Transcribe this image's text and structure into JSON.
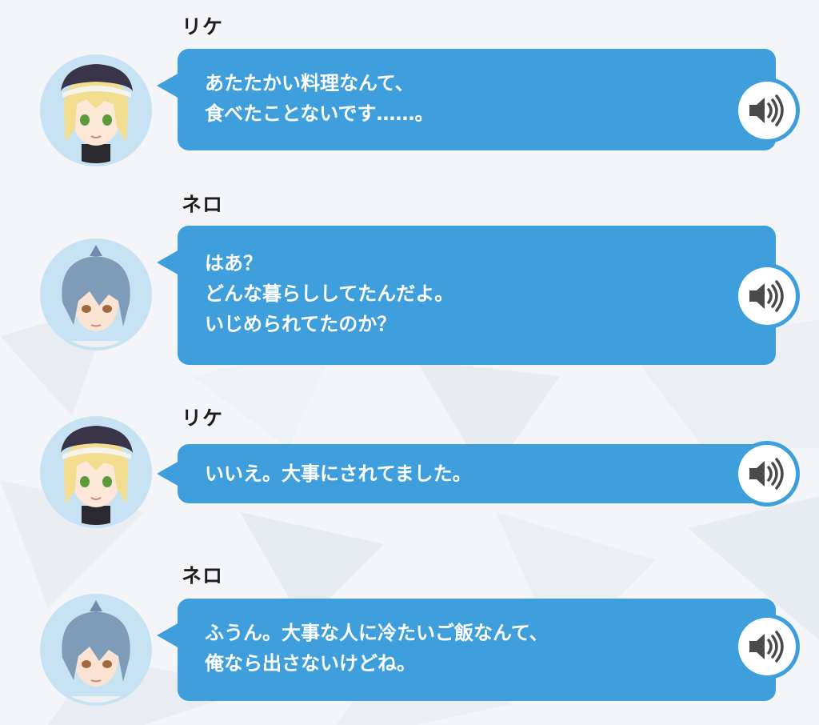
{
  "messages": [
    {
      "speaker": "リケ",
      "avatar": "rike-avatar",
      "lines": "あたたかい料理なんて、\n食べたことないです……。",
      "voice_icon": "speaker-icon"
    },
    {
      "speaker": "ネロ",
      "avatar": "nero-avatar",
      "lines": "はあ？\nどんな暮らししてたんだよ。\nいじめられてたのか？",
      "voice_icon": "speaker-icon"
    },
    {
      "speaker": "リケ",
      "avatar": "rike-avatar",
      "lines": "いいえ。大事にされてました。",
      "voice_icon": "speaker-icon"
    },
    {
      "speaker": "ネロ",
      "avatar": "nero-avatar",
      "lines": "ふうん。大事な人に冷たいご飯なんて、\n俺なら出さないけどね。",
      "voice_icon": "speaker-icon"
    }
  ],
  "colors": {
    "bubble": "#3e9fdc",
    "bubble_text": "#ffffff",
    "speaker_name": "#1d1d1d",
    "avatar_ring": "#c7e3f3"
  }
}
